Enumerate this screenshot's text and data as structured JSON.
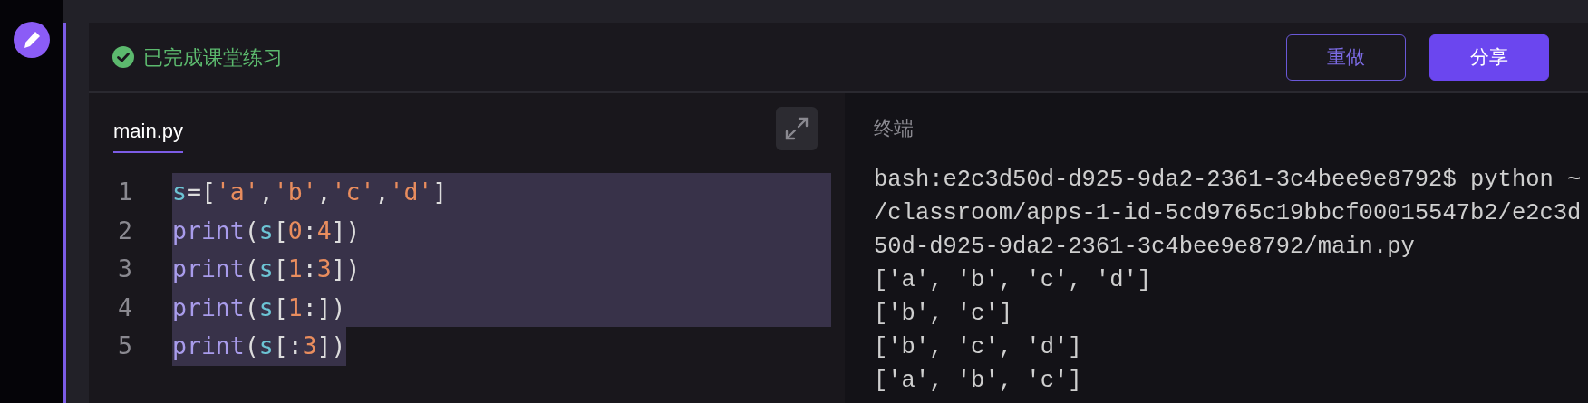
{
  "status": {
    "text": "已完成课堂练习",
    "completed": true
  },
  "buttons": [
    {
      "label": "重做",
      "kind": "outline"
    },
    {
      "label": "分享",
      "kind": "primary"
    }
  ],
  "editor": {
    "tabs": [
      {
        "label": "main.py",
        "selected": true
      }
    ],
    "lines": [
      {
        "number": "1",
        "selected": true,
        "tokens": [
          {
            "kind": "var",
            "text": "s"
          },
          {
            "kind": "punct",
            "text": "=["
          },
          {
            "kind": "string",
            "text": "'a'"
          },
          {
            "kind": "punct",
            "text": ","
          },
          {
            "kind": "string",
            "text": "'b'"
          },
          {
            "kind": "punct",
            "text": ","
          },
          {
            "kind": "string",
            "text": "'c'"
          },
          {
            "kind": "punct",
            "text": ","
          },
          {
            "kind": "string",
            "text": "'d'"
          },
          {
            "kind": "punct",
            "text": "]"
          }
        ]
      },
      {
        "number": "2",
        "selected": true,
        "tokens": [
          {
            "kind": "func",
            "text": "print"
          },
          {
            "kind": "punct",
            "text": "("
          },
          {
            "kind": "var",
            "text": "s"
          },
          {
            "kind": "punct",
            "text": "["
          },
          {
            "kind": "number",
            "text": "0"
          },
          {
            "kind": "punct",
            "text": ":"
          },
          {
            "kind": "number",
            "text": "4"
          },
          {
            "kind": "punct",
            "text": "])"
          }
        ]
      },
      {
        "number": "3",
        "selected": true,
        "tokens": [
          {
            "kind": "func",
            "text": "print"
          },
          {
            "kind": "punct",
            "text": "("
          },
          {
            "kind": "var",
            "text": "s"
          },
          {
            "kind": "punct",
            "text": "["
          },
          {
            "kind": "number",
            "text": "1"
          },
          {
            "kind": "punct",
            "text": ":"
          },
          {
            "kind": "number",
            "text": "3"
          },
          {
            "kind": "punct",
            "text": "])"
          }
        ]
      },
      {
        "number": "4",
        "selected": true,
        "tokens": [
          {
            "kind": "func",
            "text": "print"
          },
          {
            "kind": "punct",
            "text": "("
          },
          {
            "kind": "var",
            "text": "s"
          },
          {
            "kind": "punct",
            "text": "["
          },
          {
            "kind": "number",
            "text": "1"
          },
          {
            "kind": "punct",
            "text": ":])"
          }
        ]
      },
      {
        "number": "5",
        "selected": true,
        "tokens": [
          {
            "kind": "func",
            "text": "print"
          },
          {
            "kind": "punct",
            "text": "("
          },
          {
            "kind": "var",
            "text": "s"
          },
          {
            "kind": "punct",
            "text": "[:"
          },
          {
            "kind": "number",
            "text": "3"
          },
          {
            "kind": "punct",
            "text": "])"
          }
        ]
      }
    ]
  },
  "terminal": {
    "title": "终端",
    "lines": [
      "bash:e2c3d50d-d925-9da2-2361-3c4bee9e8792$ python ~",
      "/classroom/apps-1-id-5cd9765c19bbcf00015547b2/e2c3d",
      "50d-d925-9da2-2361-3c4bee9e8792/main.py",
      "['a', 'b', 'c', 'd']",
      "['b', 'c']",
      "['b', 'c', 'd']",
      "['a', 'b', 'c']"
    ]
  }
}
